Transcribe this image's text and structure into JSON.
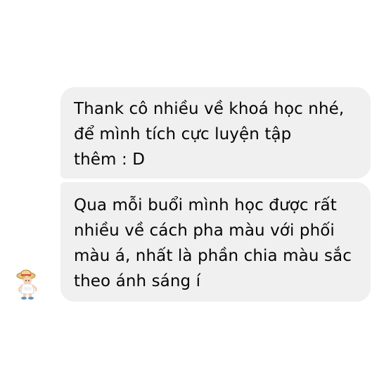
{
  "messages": [
    {
      "lines": [
        "Thank cô nhiều về khoá học nhé,",
        "để mình tích cực luyện tập",
        "thêm : D"
      ]
    },
    {
      "lines": [
        "Qua mỗi buổi mình học được rất",
        "nhiều về cách pha màu với phối",
        "màu á, nhất là phần chia màu sắc",
        "theo ánh sáng í"
      ]
    }
  ],
  "avatar": {
    "icon": "sticker-avatar-icon"
  },
  "colors": {
    "bubble_bg": "#f0f0f0",
    "text": "#050505",
    "background": "#ffffff"
  }
}
